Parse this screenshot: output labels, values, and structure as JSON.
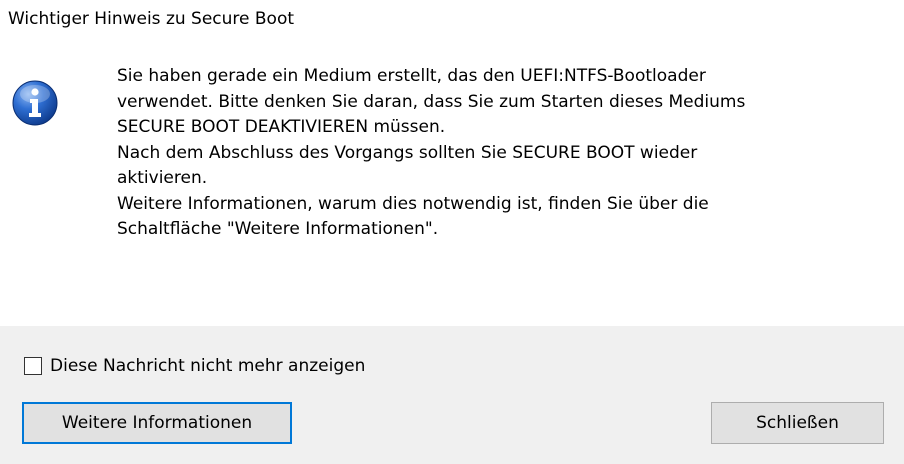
{
  "dialog": {
    "title": "Wichtiger Hinweis zu Secure Boot",
    "icon": "information-icon",
    "message_lines": [
      "Sie haben gerade ein Medium erstellt, das den UEFI:NTFS-Bootloader",
      "verwendet. Bitte denken Sie daran, dass Sie zum Starten dieses Mediums",
      "SECURE BOOT DEAKTIVIEREN müssen.",
      "Nach dem Abschluss des Vorgangs sollten Sie SECURE BOOT wieder",
      "aktivieren.",
      "Weitere Informationen, warum dies notwendig ist, finden Sie über die",
      "Schaltfläche \"Weitere Informationen\"."
    ],
    "checkbox": {
      "label": "Diese Nachricht nicht mehr anzeigen",
      "checked": false
    },
    "buttons": {
      "more_info": "Weitere Informationen",
      "close": "Schließen"
    },
    "colors": {
      "footer_bg": "#f0f0f0",
      "focus_border": "#0078d7",
      "icon_blue": "#1a56b8"
    }
  }
}
